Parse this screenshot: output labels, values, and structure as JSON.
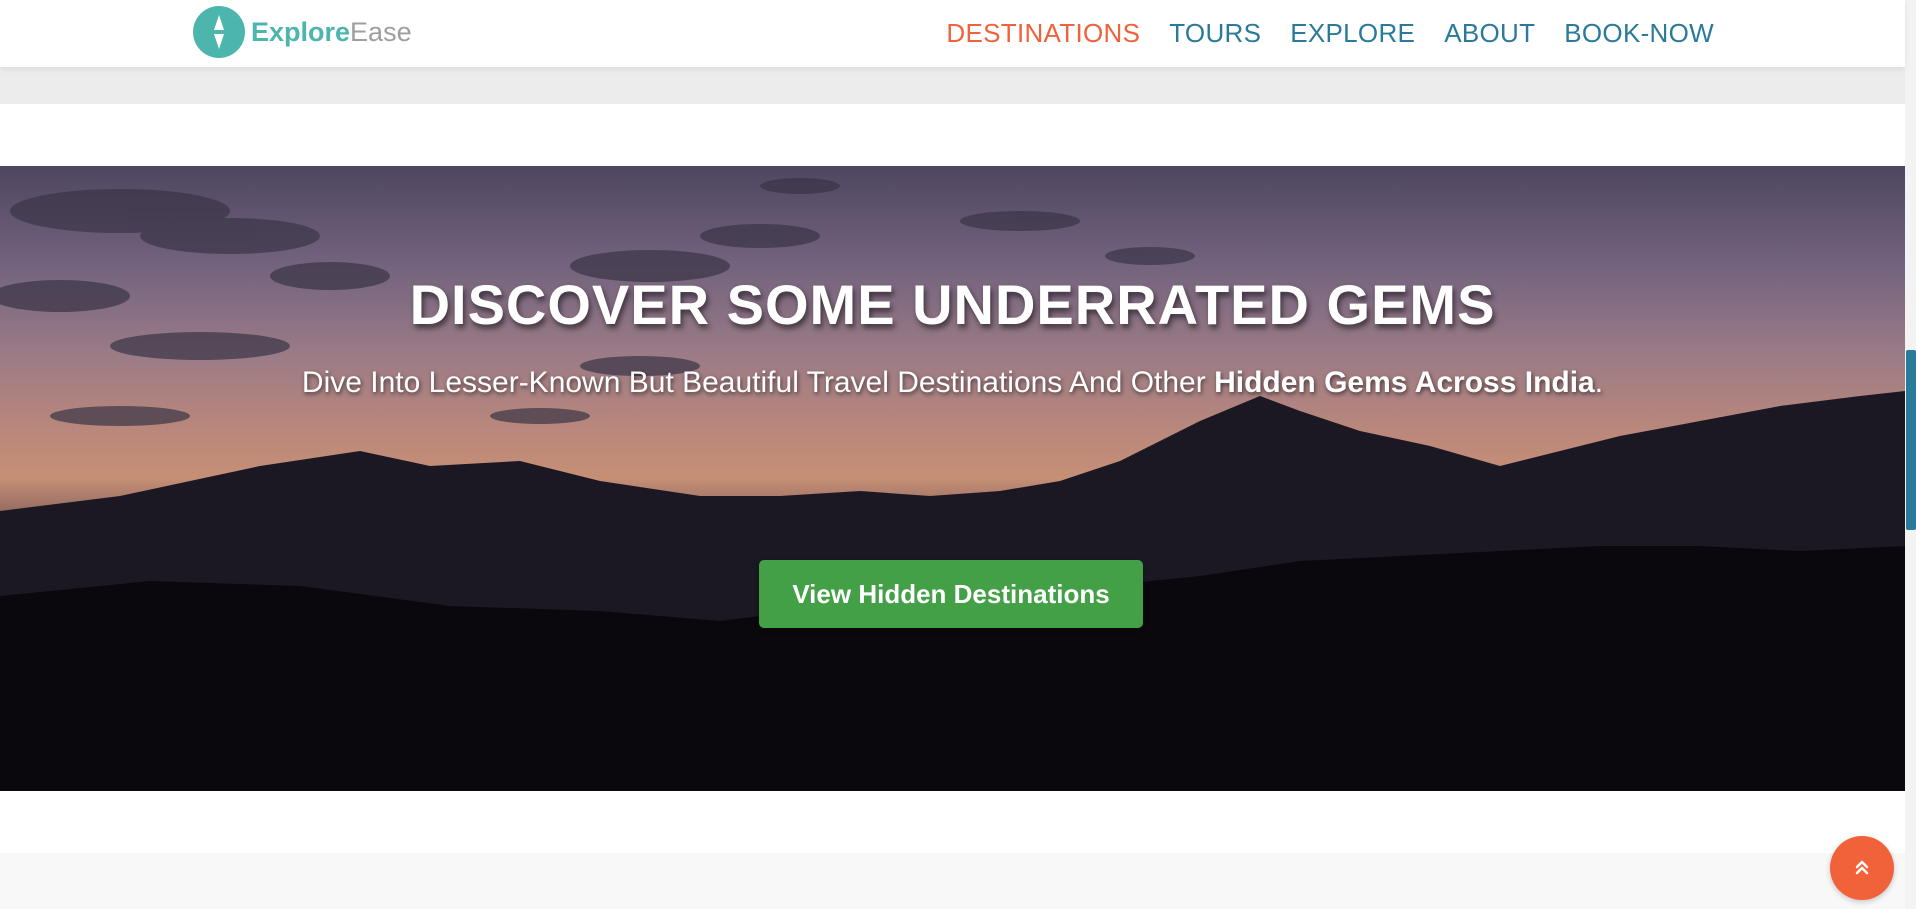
{
  "brand": {
    "name_part1": "Explore",
    "name_part2": "Ease",
    "icon": "compass-icon"
  },
  "nav": {
    "items": [
      {
        "label": "DESTINATIONS",
        "active": true
      },
      {
        "label": "TOURS",
        "active": false
      },
      {
        "label": "EXPLORE",
        "active": false
      },
      {
        "label": "ABOUT",
        "active": false
      },
      {
        "label": "BOOK-NOW",
        "active": false
      }
    ]
  },
  "hero": {
    "title": "DISCOVER SOME UNDERRATED GEMS",
    "subtitle_plain": "Dive Into Lesser-Known But Beautiful Travel Destinations And Other ",
    "subtitle_bold": "Hidden Gems Across India",
    "subtitle_end": ".",
    "cta_label": "View Hidden Destinations"
  },
  "back_to_top": {
    "icon": "double-chevron-up-icon"
  },
  "colors": {
    "brand_teal": "#4db6ac",
    "nav_link": "#2a7a9a",
    "nav_active": "#f2623a",
    "cta_green": "#43a047",
    "back_to_top": "#f2623a"
  }
}
